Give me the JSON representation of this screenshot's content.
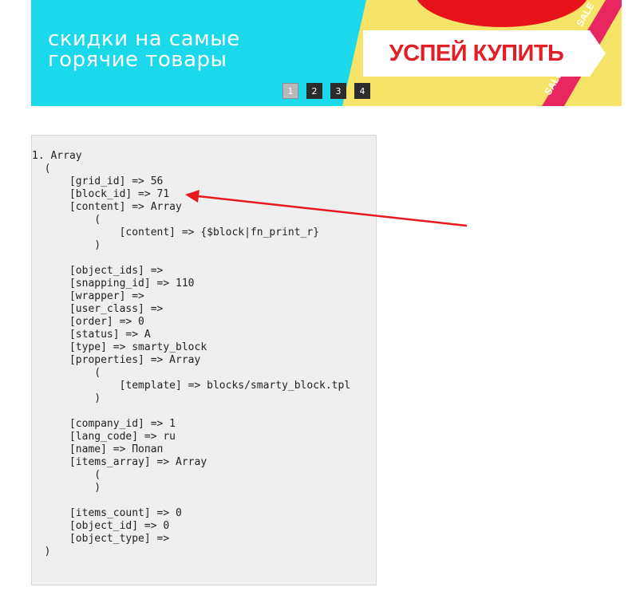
{
  "banner": {
    "promo_line1": "скидки на самые",
    "promo_line2": "горячие товары",
    "cta_label": "УСПЕЙ КУПИТЬ",
    "sale_label": "SALE",
    "pages": [
      "1",
      "2",
      "3",
      "4"
    ],
    "active_page": "1",
    "colors": {
      "cyan": "#1bd8ea",
      "yellow": "#f5e468",
      "ribbon": "#e8265f",
      "tomato": "#e8131a",
      "cta_text": "#e01f26"
    }
  },
  "debug_output": {
    "lines": [
      "1. Array",
      "  (",
      "      [grid_id] => 56",
      "      [block_id] => 71",
      "      [content] => Array",
      "          (",
      "              [content] => {$block|fn_print_r}",
      "          )",
      "",
      "      [object_ids] =>",
      "      [snapping_id] => 110",
      "      [wrapper] =>",
      "      [user_class] =>",
      "      [order] => 0",
      "      [status] => A",
      "      [type] => smarty_block",
      "      [properties] => Array",
      "          (",
      "              [template] => blocks/smarty_block.tpl",
      "          )",
      "",
      "      [company_id] => 1",
      "      [lang_code] => ru",
      "      [name] => Попап",
      "      [items_array] => Array",
      "          (",
      "          )",
      "",
      "      [items_count] => 0",
      "      [object_id] => 0",
      "      [object_type] =>",
      "  )"
    ]
  },
  "annotation": {
    "arrow_color": "#e8191c",
    "points_to": "[block_id] => 71"
  }
}
